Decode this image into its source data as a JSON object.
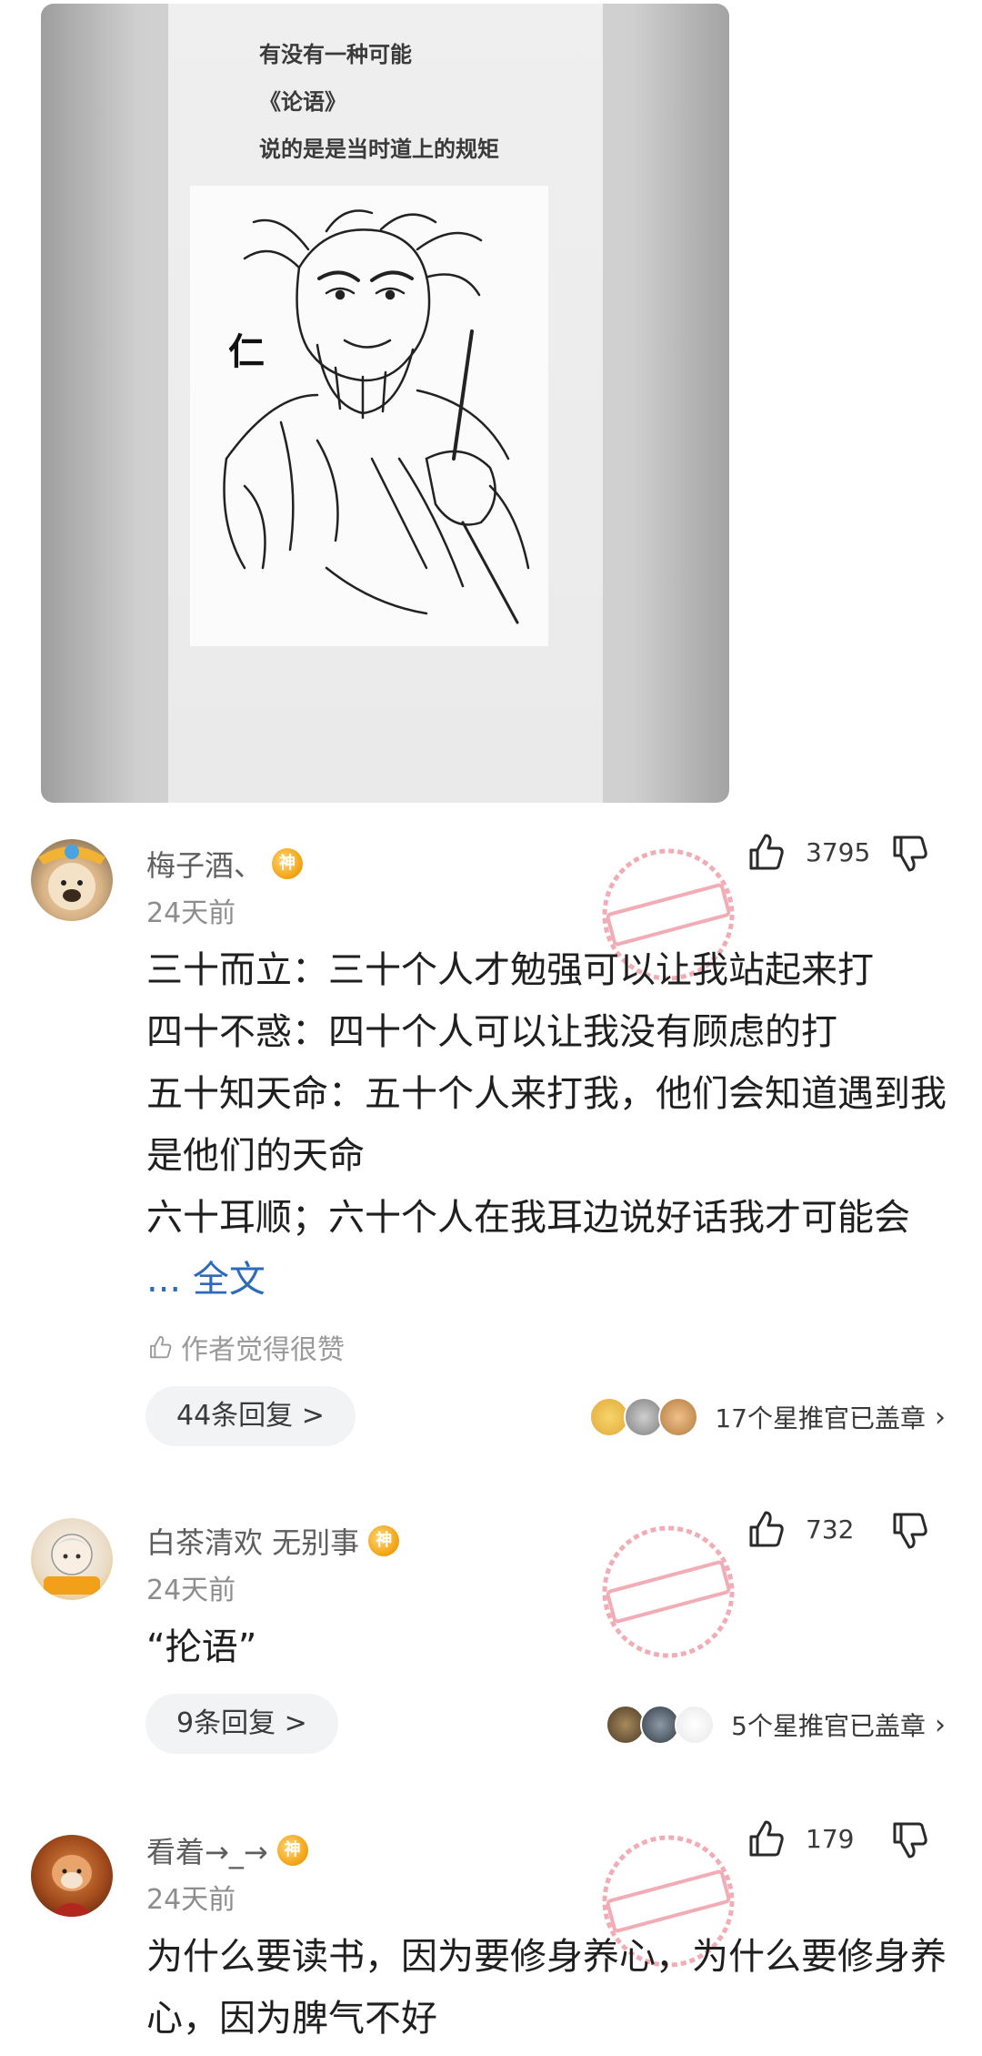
{
  "post_image": {
    "lines": [
      "有没有一种可能",
      "《论语》",
      "说的是是当时道上的规矩"
    ],
    "glyph": "仁"
  },
  "comments": [
    {
      "username": "梅子酒、",
      "badge": "神",
      "time": "24天前",
      "likes": "3795",
      "body": [
        "三十而立：三十个人才勉强可以让我站起来打",
        "四十不惑：四十个人可以让我没有顾虑的打",
        "五十知天命：五十个人来打我，他们会知道遇到我是他们的天命",
        "六十耳顺；六十个人在我耳边说好话我才可能会"
      ],
      "more": "... 全文",
      "author_liked": "作者觉得很赞",
      "replies": "44条回复 >",
      "stars": "17个星推官已盖章"
    },
    {
      "username": "白茶清欢 无别事",
      "badge": "神",
      "time": "24天前",
      "likes": "732",
      "body": [
        "“抡语”"
      ],
      "replies": "9条回复 >",
      "stars": "5个星推官已盖章"
    },
    {
      "username": "看着→_→",
      "badge": "神",
      "time": "24天前",
      "likes": "179",
      "body": [
        "为什么要读书，因为要修身养心，为什么要修身养心，因为脾气不好"
      ]
    }
  ],
  "icons": {
    "like": "thumbs-up-icon",
    "dislike": "thumbs-down-icon",
    "chevron": "chevron-right-icon",
    "watermark": "shen-ping-stamp"
  },
  "colors": {
    "badge": "#f4a81c",
    "link": "#2d6bb8",
    "watermark": "#e86a7a",
    "pill": "#f2f3f5"
  }
}
